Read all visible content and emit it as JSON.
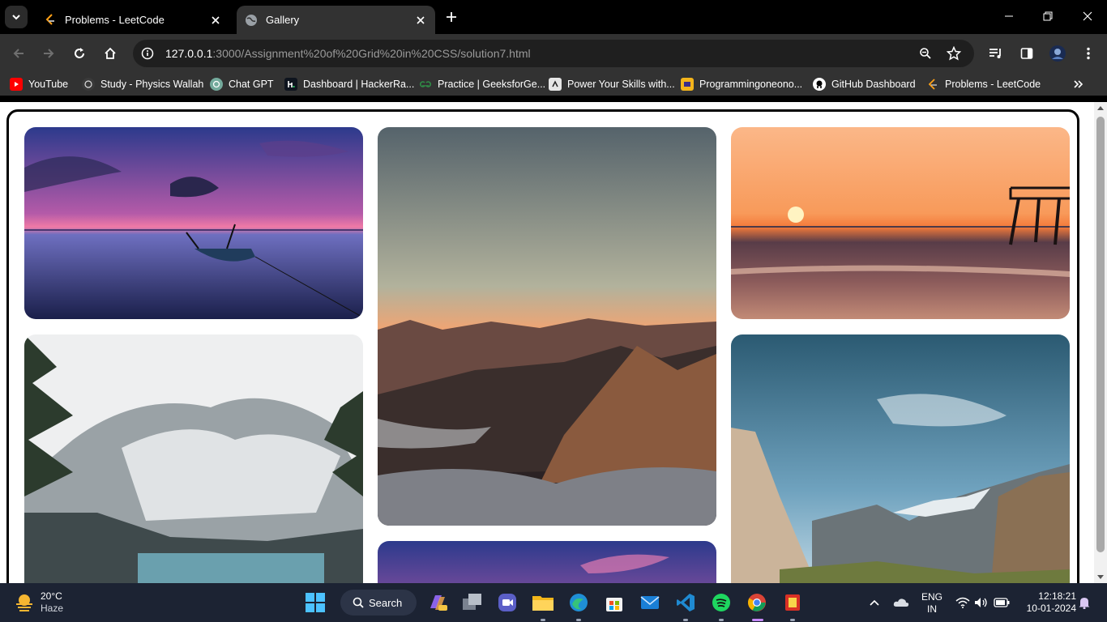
{
  "tabs": [
    {
      "title": "Problems - LeetCode",
      "active": false,
      "favicon": "leetcode-icon"
    },
    {
      "title": "Gallery",
      "active": true,
      "favicon": "globe-icon"
    }
  ],
  "address": {
    "host": "127.0.0.1",
    "path": ":3000/Assignment%20of%20Grid%20in%20CSS/solution7.html"
  },
  "bookmarks": [
    {
      "label": "YouTube",
      "icon": "youtube-icon",
      "color": "#ff0000"
    },
    {
      "label": "Study - Physics Wallah",
      "icon": "pw-icon",
      "color": "#3a3a3a"
    },
    {
      "label": "Chat GPT",
      "icon": "chatgpt-icon",
      "color": "#74aa9c"
    },
    {
      "label": "Dashboard | HackerRa...",
      "icon": "hackerrank-icon",
      "color": "#0e141e"
    },
    {
      "label": "Practice | GeeksforGe...",
      "icon": "gfg-icon",
      "color": "#2f8d46"
    },
    {
      "label": "Power Your Skills with...",
      "icon": "skills-icon",
      "color": "#e6e6e6"
    },
    {
      "label": "Programmingoneono...",
      "icon": "programming-icon",
      "color": "#f3b41b"
    },
    {
      "label": "GitHub Dashboard",
      "icon": "github-icon",
      "color": "#ffffff"
    },
    {
      "label": "Problems - LeetCode",
      "icon": "leetcode-icon",
      "color": "#ffa116"
    }
  ],
  "gallery": [
    {
      "name": "gallery-image-lake-boat-sunset"
    },
    {
      "name": "gallery-image-mountain-range-dusk"
    },
    {
      "name": "gallery-image-ocean-pier-sunset"
    },
    {
      "name": "gallery-image-snowy-mountain-lake"
    },
    {
      "name": "gallery-image-valley-cliffs"
    },
    {
      "name": "gallery-image-purple-sky"
    }
  ],
  "taskbar": {
    "weather_temp": "20°C",
    "weather_desc": "Haze",
    "search_label": "Search",
    "lang_top": "ENG",
    "lang_bottom": "IN",
    "time": "12:18:21",
    "date": "10-01-2024"
  },
  "colors": {
    "chrome_dark": "#000000",
    "toolbar": "#323232",
    "taskbar": "#1c2333",
    "accent": "#c58af9"
  }
}
